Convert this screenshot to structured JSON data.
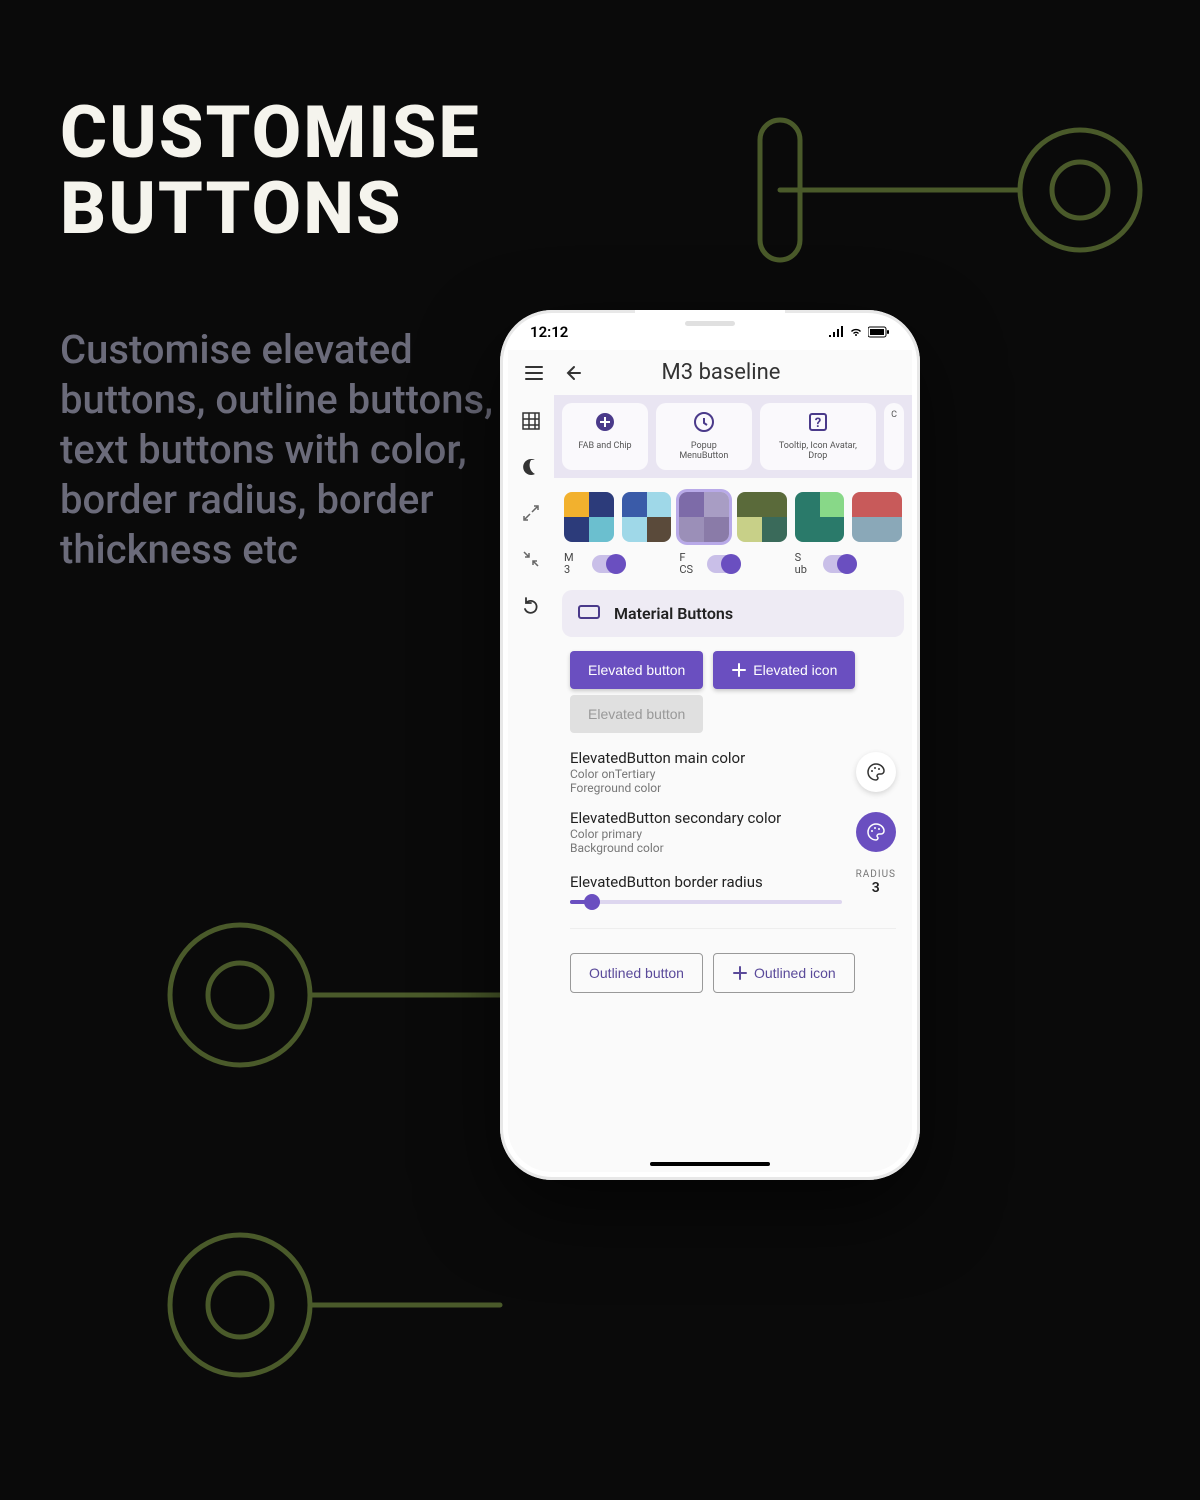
{
  "headline": {
    "line1": "CUSTOMISE",
    "line2": "BUTTONS"
  },
  "subhead": "Customise elevated buttons, outline buttons, text buttons with color, border radius, border thickness etc",
  "status": {
    "time": "12:12"
  },
  "appbar": {
    "title": "M3 baseline"
  },
  "tabs": [
    {
      "icon": "plus-circle",
      "label": "FAB and Chip"
    },
    {
      "icon": "clock",
      "label": "Popup MenuButton"
    },
    {
      "icon": "help",
      "label": "Tooltip, Icon Avatar, Drop"
    },
    {
      "icon": "",
      "label": "C"
    }
  ],
  "palettes": [
    {
      "c": [
        "#f2b12e",
        "#2c3b7a",
        "#2c3b7a",
        "#6bbfcf"
      ],
      "selected": false
    },
    {
      "c": [
        "#3a5ba8",
        "#9fd8e8",
        "#9fd8e8",
        "#5a4a3a"
      ],
      "selected": false
    },
    {
      "c": [
        "#7d6ba8",
        "#a89dc4",
        "#9b8fb8",
        "#8a7ba8"
      ],
      "selected": true
    },
    {
      "c": [
        "#5a6a3a",
        "#5a6a3a",
        "#c8d088",
        "#3a6a5a"
      ],
      "selected": false
    },
    {
      "c": [
        "#2a7a6a",
        "#88d888",
        "#2a7a6a",
        "#2a7a6a"
      ],
      "selected": false
    },
    {
      "c": [
        "#c85a5a",
        "#c85a5a",
        "#8aa8b8",
        "#8aa8b8"
      ],
      "selected": false
    }
  ],
  "toggles": [
    {
      "label": "M3",
      "on": true
    },
    {
      "label": "FCS",
      "on": true
    },
    {
      "label": "Sub",
      "on": true
    }
  ],
  "section_title": "Material Buttons",
  "buttons": {
    "elevated": "Elevated button",
    "elevated_icon": "Elevated icon",
    "elevated_disabled": "Elevated button",
    "outlined": "Outlined button",
    "outlined_icon": "Outlined icon"
  },
  "props": {
    "main": {
      "title": "ElevatedButton main color",
      "sub1": "Color onTertiary",
      "sub2": "Foreground color"
    },
    "secondary": {
      "title": "ElevatedButton secondary color",
      "sub1": "Color primary",
      "sub2": "Background color"
    },
    "radius": {
      "title": "ElevatedButton border radius",
      "label": "RADIUS",
      "value": "3"
    }
  }
}
